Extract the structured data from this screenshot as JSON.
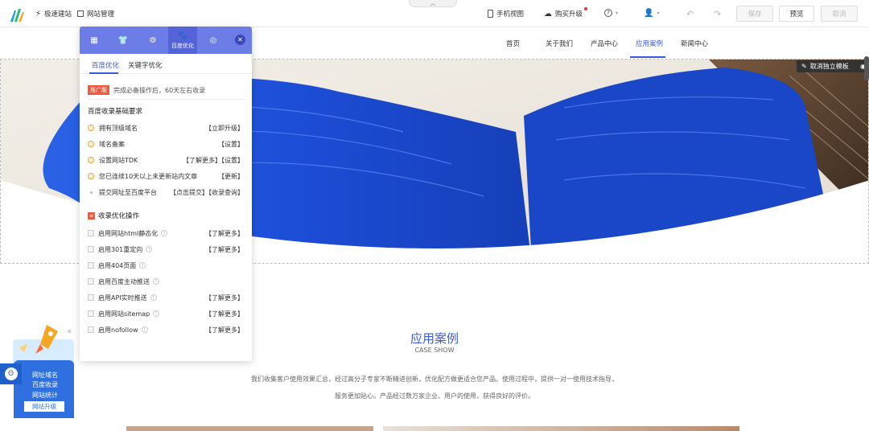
{
  "topbar": {
    "quick_build": "极速建站",
    "site_manage": "网站管理",
    "mobile_view": "手机视图",
    "buy_upgrade": "购买升级",
    "save": "保存",
    "preview": "预览",
    "publish": "取消"
  },
  "site_nav": {
    "items": [
      "首页",
      "关于我们",
      "产品中心",
      "应用案例",
      "新闻中心"
    ],
    "active": "应用案例"
  },
  "hero": {
    "cancel_module": "取消独立模板"
  },
  "section": {
    "title": "应用案例",
    "subtitle": "CASE SHOW",
    "desc_line1": "我们收集客户使用效果汇总，经过高分子专家不断精进创新，优化配方做更适合您产品。使用过程中，提供一对一使用技术指导，",
    "desc_line2": "服务更加贴心。产品经过数万家企业、用户的使用，获得良好的评价。"
  },
  "panel": {
    "active_tab_label": "百度优化",
    "subtabs": [
      "百度优化",
      "关键字优化"
    ],
    "tip_tag": "推广版",
    "tip_text": "完成必备操作后，60天左右收录",
    "basic_title": "百度收录基础要求",
    "basic_items": [
      {
        "label": "拥有顶级域名",
        "action": "【立即升级】"
      },
      {
        "label": "域名备案",
        "action": "【设置】"
      },
      {
        "label": "设置网站TDK",
        "action": "【了解更多】【设置】"
      },
      {
        "label": "您已连续10天以上未更新站内文章",
        "action": "【更新】"
      },
      {
        "label": "提交网址至百度平台",
        "action": "【点击提交】【收录查询】"
      }
    ],
    "opt_title": "收录优化操作",
    "opt_items": [
      {
        "label": "启用网站html静态化",
        "action": "【了解更多】"
      },
      {
        "label": "启用301重定向",
        "action": "【了解更多】"
      },
      {
        "label": "启用404页面",
        "action": ""
      },
      {
        "label": "启用百度主动推送",
        "action": ""
      },
      {
        "label": "启用API实时推送",
        "action": "【了解更多】"
      },
      {
        "label": "启用网站sitemap",
        "action": "【了解更多】"
      },
      {
        "label": "启用nofollow",
        "action": "【了解更多】"
      }
    ]
  },
  "promo": {
    "lines": [
      "网址域名",
      "百度收录",
      "网站统计"
    ],
    "button": "网站升级"
  },
  "colors": {
    "accent": "#3b5bdb",
    "panel_header": "#6d7de8",
    "tag": "#f05a3c",
    "paint_blue": "#1f4fd8"
  }
}
